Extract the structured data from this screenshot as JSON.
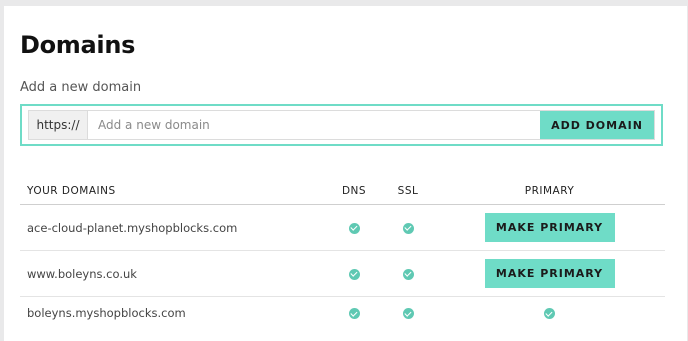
{
  "page": {
    "title": "Domains"
  },
  "add_domain": {
    "label": "Add a new domain",
    "prefix": "https://",
    "placeholder": "Add a new domain",
    "button_label": "ADD DOMAIN"
  },
  "table": {
    "headers": {
      "domain": "YOUR DOMAINS",
      "dns": "DNS",
      "ssl": "SSL",
      "primary": "PRIMARY"
    },
    "rows": [
      {
        "domain": "ace-cloud-planet.myshopblocks.com",
        "dns": "check-icon",
        "ssl": "check-icon",
        "primary_action": "MAKE PRIMARY"
      },
      {
        "domain": "www.boleyns.co.uk",
        "dns": "check-icon",
        "ssl": "check-icon",
        "primary_action": "MAKE PRIMARY"
      },
      {
        "domain": "boleyns.myshopblocks.com",
        "dns": "check-icon",
        "ssl": "check-icon",
        "primary_status": "check-icon"
      }
    ]
  },
  "colors": {
    "accent": "#6fdcc7",
    "check": "#5fc9b3",
    "background": "#e9e9ea"
  }
}
